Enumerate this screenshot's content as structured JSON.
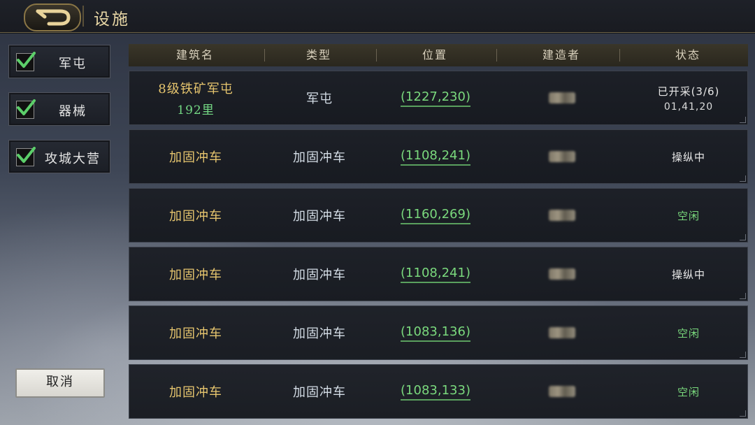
{
  "header": {
    "title": "设施"
  },
  "filters": [
    {
      "label": "军屯",
      "checked": true
    },
    {
      "label": "器械",
      "checked": true
    },
    {
      "label": "攻城大营",
      "checked": true
    }
  ],
  "cancel_label": "取消",
  "table": {
    "columns": [
      "建筑名",
      "类型",
      "位置",
      "建造者",
      "状态"
    ],
    "rows": [
      {
        "name": "8级铁矿军屯",
        "distance": "192里",
        "type": "军屯",
        "position": "(1227,230)",
        "status": "已开采(3/6)",
        "timer": "01,41,20",
        "status_kind": "active"
      },
      {
        "name": "加固冲车",
        "distance": "",
        "type": "加固冲车",
        "position": "(1108,241)",
        "status": "操纵中",
        "timer": "",
        "status_kind": "active"
      },
      {
        "name": "加固冲车",
        "distance": "",
        "type": "加固冲车",
        "position": "(1160,269)",
        "status": "空闲",
        "timer": "",
        "status_kind": "idle"
      },
      {
        "name": "加固冲车",
        "distance": "",
        "type": "加固冲车",
        "position": "(1108,241)",
        "status": "操纵中",
        "timer": "",
        "status_kind": "active"
      },
      {
        "name": "加固冲车",
        "distance": "",
        "type": "加固冲车",
        "position": "(1083,136)",
        "status": "空闲",
        "timer": "",
        "status_kind": "idle"
      },
      {
        "name": "加固冲车",
        "distance": "",
        "type": "加固冲车",
        "position": "(1083,133)",
        "status": "空闲",
        "timer": "",
        "status_kind": "idle"
      }
    ]
  },
  "colors": {
    "accent_gold": "#e6c56e",
    "coord_green": "#7ad97d",
    "idle_green": "#7ad97d"
  }
}
